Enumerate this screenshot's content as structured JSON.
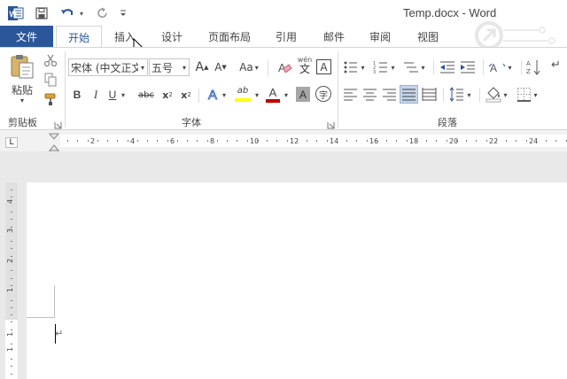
{
  "title_bar": {
    "title": "Temp.docx - Word",
    "app_icon_letter": "W",
    "icons": [
      "word-app-icon",
      "save-icon",
      "undo-icon",
      "redo-icon",
      "customize-qa-icon"
    ]
  },
  "tabs": {
    "file": "文件",
    "items": [
      "开始",
      "插入",
      "设计",
      "页面布局",
      "引用",
      "邮件",
      "审阅",
      "视图"
    ],
    "active": "开始",
    "hover": "插入"
  },
  "ribbon": {
    "clipboard": {
      "label": "剪贴板",
      "paste_label": "粘贴",
      "icons": [
        "paste-icon",
        "cut-icon",
        "copy-icon",
        "format-painter-icon"
      ]
    },
    "font": {
      "label": "字体",
      "font_name": "宋体 (中文正文",
      "font_size": "五号",
      "grow_label": "A",
      "shrink_label": "A",
      "case_label": "Aa",
      "pinyin_top": "wén",
      "pinyin_bottom": "文",
      "border_char": "A",
      "bold": "B",
      "italic": "I",
      "underline": "U",
      "strike": "abc",
      "subscript": "x",
      "sub_mark": "2",
      "superscript": "x",
      "sup_mark": "2",
      "effects": "A",
      "highlight": "ab",
      "font_color": "A",
      "shading": "A",
      "enclose": "字",
      "colors": {
        "highlight": "#ffff00",
        "font_color": "#c00000",
        "shading": "#a6a6a6"
      }
    },
    "paragraph": {
      "label": "段落",
      "icons": [
        "bullets-icon",
        "numbering-icon",
        "multilevel-list-icon",
        "decrease-indent-icon",
        "increase-indent-icon",
        "asian-layout-icon",
        "sort-icon",
        "align-left-icon",
        "center-icon",
        "align-right-icon",
        "justify-icon",
        "distributed-icon",
        "line-spacing-icon",
        "shading-icon",
        "borders-icon"
      ]
    }
  },
  "ruler": {
    "corner": "L",
    "h_numbers": [
      "2",
      "4",
      "6",
      "8",
      "10",
      "12",
      "14",
      "16",
      "18",
      "20",
      "22",
      "24"
    ],
    "v_numbers": [
      "4",
      "3",
      "2",
      "1",
      "1",
      "1"
    ]
  },
  "document": {
    "paragraph_mark": "↵"
  },
  "accent_colors": {
    "file_tab": "#2b579a",
    "active_tab_text": "#2b579a"
  }
}
